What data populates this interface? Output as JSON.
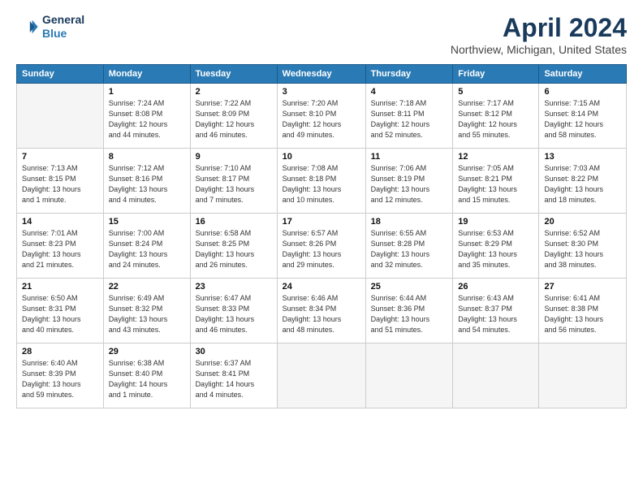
{
  "header": {
    "logo_line1": "General",
    "logo_line2": "Blue",
    "title": "April 2024",
    "subtitle": "Northview, Michigan, United States"
  },
  "calendar": {
    "headers": [
      "Sunday",
      "Monday",
      "Tuesday",
      "Wednesday",
      "Thursday",
      "Friday",
      "Saturday"
    ],
    "rows": [
      [
        {
          "day": "",
          "info": "",
          "empty": true
        },
        {
          "day": "1",
          "info": "Sunrise: 7:24 AM\nSunset: 8:08 PM\nDaylight: 12 hours\nand 44 minutes."
        },
        {
          "day": "2",
          "info": "Sunrise: 7:22 AM\nSunset: 8:09 PM\nDaylight: 12 hours\nand 46 minutes."
        },
        {
          "day": "3",
          "info": "Sunrise: 7:20 AM\nSunset: 8:10 PM\nDaylight: 12 hours\nand 49 minutes."
        },
        {
          "day": "4",
          "info": "Sunrise: 7:18 AM\nSunset: 8:11 PM\nDaylight: 12 hours\nand 52 minutes."
        },
        {
          "day": "5",
          "info": "Sunrise: 7:17 AM\nSunset: 8:12 PM\nDaylight: 12 hours\nand 55 minutes."
        },
        {
          "day": "6",
          "info": "Sunrise: 7:15 AM\nSunset: 8:14 PM\nDaylight: 12 hours\nand 58 minutes."
        }
      ],
      [
        {
          "day": "7",
          "info": "Sunrise: 7:13 AM\nSunset: 8:15 PM\nDaylight: 13 hours\nand 1 minute."
        },
        {
          "day": "8",
          "info": "Sunrise: 7:12 AM\nSunset: 8:16 PM\nDaylight: 13 hours\nand 4 minutes."
        },
        {
          "day": "9",
          "info": "Sunrise: 7:10 AM\nSunset: 8:17 PM\nDaylight: 13 hours\nand 7 minutes."
        },
        {
          "day": "10",
          "info": "Sunrise: 7:08 AM\nSunset: 8:18 PM\nDaylight: 13 hours\nand 10 minutes."
        },
        {
          "day": "11",
          "info": "Sunrise: 7:06 AM\nSunset: 8:19 PM\nDaylight: 13 hours\nand 12 minutes."
        },
        {
          "day": "12",
          "info": "Sunrise: 7:05 AM\nSunset: 8:21 PM\nDaylight: 13 hours\nand 15 minutes."
        },
        {
          "day": "13",
          "info": "Sunrise: 7:03 AM\nSunset: 8:22 PM\nDaylight: 13 hours\nand 18 minutes."
        }
      ],
      [
        {
          "day": "14",
          "info": "Sunrise: 7:01 AM\nSunset: 8:23 PM\nDaylight: 13 hours\nand 21 minutes."
        },
        {
          "day": "15",
          "info": "Sunrise: 7:00 AM\nSunset: 8:24 PM\nDaylight: 13 hours\nand 24 minutes."
        },
        {
          "day": "16",
          "info": "Sunrise: 6:58 AM\nSunset: 8:25 PM\nDaylight: 13 hours\nand 26 minutes."
        },
        {
          "day": "17",
          "info": "Sunrise: 6:57 AM\nSunset: 8:26 PM\nDaylight: 13 hours\nand 29 minutes."
        },
        {
          "day": "18",
          "info": "Sunrise: 6:55 AM\nSunset: 8:28 PM\nDaylight: 13 hours\nand 32 minutes."
        },
        {
          "day": "19",
          "info": "Sunrise: 6:53 AM\nSunset: 8:29 PM\nDaylight: 13 hours\nand 35 minutes."
        },
        {
          "day": "20",
          "info": "Sunrise: 6:52 AM\nSunset: 8:30 PM\nDaylight: 13 hours\nand 38 minutes."
        }
      ],
      [
        {
          "day": "21",
          "info": "Sunrise: 6:50 AM\nSunset: 8:31 PM\nDaylight: 13 hours\nand 40 minutes."
        },
        {
          "day": "22",
          "info": "Sunrise: 6:49 AM\nSunset: 8:32 PM\nDaylight: 13 hours\nand 43 minutes."
        },
        {
          "day": "23",
          "info": "Sunrise: 6:47 AM\nSunset: 8:33 PM\nDaylight: 13 hours\nand 46 minutes."
        },
        {
          "day": "24",
          "info": "Sunrise: 6:46 AM\nSunset: 8:34 PM\nDaylight: 13 hours\nand 48 minutes."
        },
        {
          "day": "25",
          "info": "Sunrise: 6:44 AM\nSunset: 8:36 PM\nDaylight: 13 hours\nand 51 minutes."
        },
        {
          "day": "26",
          "info": "Sunrise: 6:43 AM\nSunset: 8:37 PM\nDaylight: 13 hours\nand 54 minutes."
        },
        {
          "day": "27",
          "info": "Sunrise: 6:41 AM\nSunset: 8:38 PM\nDaylight: 13 hours\nand 56 minutes."
        }
      ],
      [
        {
          "day": "28",
          "info": "Sunrise: 6:40 AM\nSunset: 8:39 PM\nDaylight: 13 hours\nand 59 minutes."
        },
        {
          "day": "29",
          "info": "Sunrise: 6:38 AM\nSunset: 8:40 PM\nDaylight: 14 hours\nand 1 minute."
        },
        {
          "day": "30",
          "info": "Sunrise: 6:37 AM\nSunset: 8:41 PM\nDaylight: 14 hours\nand 4 minutes."
        },
        {
          "day": "",
          "info": "",
          "empty": true
        },
        {
          "day": "",
          "info": "",
          "empty": true
        },
        {
          "day": "",
          "info": "",
          "empty": true
        },
        {
          "day": "",
          "info": "",
          "empty": true
        }
      ]
    ]
  }
}
